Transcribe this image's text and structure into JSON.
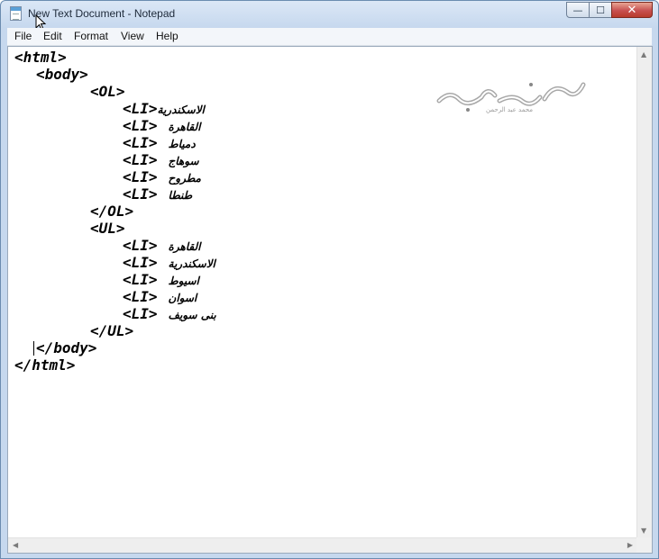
{
  "window": {
    "title": "New Text Document - Notepad",
    "controls": {
      "minimize": "—",
      "maximize": "☐",
      "close": "✕"
    }
  },
  "menu": [
    "File",
    "Edit",
    "Format",
    "View",
    "Help"
  ],
  "document": {
    "lines": [
      {
        "tag": "<html>",
        "text": ""
      },
      {
        "tag": "<body>",
        "text": ""
      },
      {
        "tag": "<OL>",
        "text": ""
      },
      {
        "tag": "<LI>",
        "text": "الاسكندرية"
      },
      {
        "tag": "<LI>",
        "text": "القاهرة"
      },
      {
        "tag": "<LI>",
        "text": "دمياط"
      },
      {
        "tag": "<LI>",
        "text": "سوهاج"
      },
      {
        "tag": "<LI>",
        "text": "مطروح"
      },
      {
        "tag": "<LI>",
        "text": "طنطا"
      },
      {
        "tag": "</OL>",
        "text": ""
      },
      {
        "tag": "<UL>",
        "text": ""
      },
      {
        "tag": "<LI>",
        "text": "القاهرة"
      },
      {
        "tag": "<LI>",
        "text": "الاسكندرية"
      },
      {
        "tag": "<LI>",
        "text": "اسيوط"
      },
      {
        "tag": "<LI>",
        "text": "اسوان"
      },
      {
        "tag": "<LI>",
        "text": "بنى سويف"
      },
      {
        "tag": "</UL>",
        "text": ""
      },
      {
        "tag": "</body>",
        "text": ""
      },
      {
        "tag": "</html>",
        "text": ""
      }
    ]
  },
  "watermark": {
    "text": "محمد عبد الرحمن"
  },
  "scrollbar": {
    "up": "▲",
    "down": "▼",
    "left": "◀",
    "right": "▶"
  }
}
